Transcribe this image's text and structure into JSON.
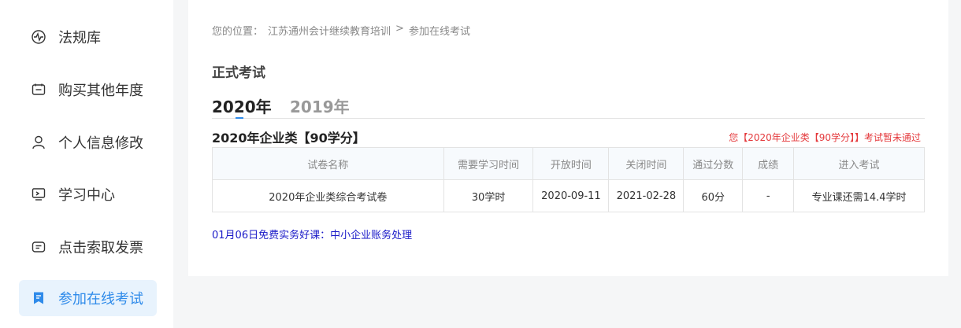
{
  "sidebar": {
    "items": [
      {
        "label": "法规库",
        "icon": "pulse-icon"
      },
      {
        "label": "购买其他年度",
        "icon": "calendar-icon"
      },
      {
        "label": "个人信息修改",
        "icon": "user-icon"
      },
      {
        "label": "学习中心",
        "icon": "monitor-icon"
      },
      {
        "label": "点击索取发票",
        "icon": "message-icon"
      },
      {
        "label": "参加在线考试",
        "icon": "exam-icon",
        "active": true
      }
    ]
  },
  "breadcrumb": {
    "prefix": "您的位置：",
    "link": "江苏通州会计继续教育培训",
    "separator": ">",
    "current": "参加在线考试"
  },
  "page_title": "正式考试",
  "year_tabs": [
    {
      "label": "2020年",
      "active": true
    },
    {
      "label": "2019年",
      "active": false
    }
  ],
  "section": {
    "title": "2020年企业类【90学分】",
    "status_note": "您【2020年企业类【90学分】】考试暂未通过"
  },
  "table": {
    "headers": [
      "试卷名称",
      "需要学习时间",
      "开放时间",
      "关闭时间",
      "通过分数",
      "成绩",
      "进入考试"
    ],
    "rows": [
      [
        "2020年企业类综合考试卷",
        "30学时",
        "2020-09-11",
        "2021-02-28",
        "60分",
        "-",
        "专业课还需14.4学时"
      ]
    ]
  },
  "promo": {
    "text": "01月06日免费实务好课：中小企业账务处理"
  },
  "colors": {
    "accent": "#2f8bea",
    "active_bg": "#e8f3fd",
    "warning": "#e4393c",
    "link": "#1a1ac8"
  }
}
